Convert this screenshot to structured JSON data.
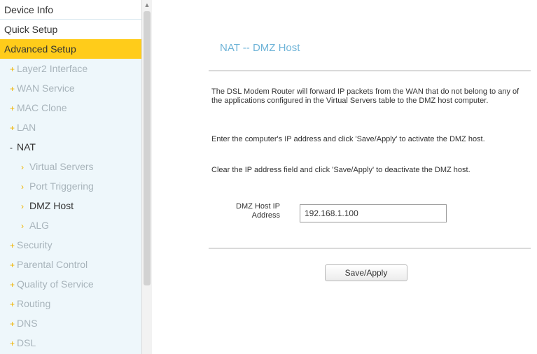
{
  "sidebar": {
    "device_info": "Device Info",
    "quick_setup": "Quick Setup",
    "advanced_setup": "Advanced Setup",
    "layer2_interface": "Layer2 Interface",
    "wan_service": "WAN Service",
    "mac_clone": "MAC Clone",
    "lan": "LAN",
    "nat": "NAT",
    "virtual_servers": "Virtual Servers",
    "port_triggering": "Port Triggering",
    "dmz_host": "DMZ Host",
    "alg": "ALG",
    "security": "Security",
    "parental_control": "Parental Control",
    "quality_of_service": "Quality of Service",
    "routing": "Routing",
    "dns": "DNS",
    "dsl": "DSL",
    "bullet_collapsed": "+",
    "bullet_expanded": "-",
    "bullet_sub": "›"
  },
  "main": {
    "title": "NAT -- DMZ Host",
    "para1": "The DSL Modem Router will forward IP packets from the WAN that do not belong to any of the applications configured in the Virtual Servers table to the DMZ host computer.",
    "para2": "Enter the computer's IP address and click 'Save/Apply' to activate the DMZ host.",
    "para3": "Clear the IP address field and click 'Save/Apply' to deactivate the DMZ host.",
    "field_label": "DMZ Host IP Address",
    "field_value": "192.168.1.100",
    "save_label": "Save/Apply"
  },
  "colors": {
    "selected_menu": "#ffcc1a",
    "title_blue": "#6fb4d8",
    "sidebar_bg": "#eef7fb",
    "bullet_orange": "#f0b400"
  },
  "icons": {
    "scroll_up": "chevron-up-icon"
  }
}
